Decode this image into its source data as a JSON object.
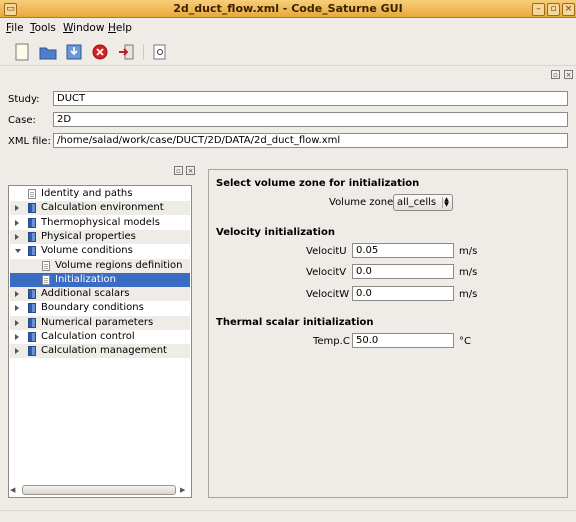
{
  "window": {
    "title": "2d_duct_flow.xml - Code_Saturne GUI"
  },
  "menubar": {
    "items": [
      {
        "label": "File",
        "key": "F",
        "rest": "ile"
      },
      {
        "label": "Tools",
        "key": "T",
        "rest": "ools"
      },
      {
        "label": "Window",
        "key": "W",
        "rest": "indow"
      },
      {
        "label": "Help",
        "key": "H",
        "rest": "elp"
      }
    ]
  },
  "toolbar": {
    "icons": [
      "new-file-icon",
      "open-folder-icon",
      "save-icon",
      "close-icon",
      "quit-icon",
      "preview-icon"
    ]
  },
  "identity": {
    "study_label": "Study:",
    "study_value": "DUCT",
    "case_label": "Case:",
    "case_value": "2D",
    "xml_label": "XML file:",
    "xml_value": "/home/salad/work/case/DUCT/2D/DATA/2d_duct_flow.xml"
  },
  "tree": {
    "items": [
      {
        "label": "Identity and paths",
        "level": 0,
        "arrow": "none",
        "icon": "page"
      },
      {
        "label": "Calculation environment",
        "level": 0,
        "arrow": "right",
        "icon": "book"
      },
      {
        "label": "Thermophysical models",
        "level": 0,
        "arrow": "right",
        "icon": "book"
      },
      {
        "label": "Physical properties",
        "level": 0,
        "arrow": "right",
        "icon": "book"
      },
      {
        "label": "Volume conditions",
        "level": 0,
        "arrow": "down",
        "icon": "book"
      },
      {
        "label": "Volume regions definition",
        "level": 1,
        "arrow": "none",
        "icon": "page"
      },
      {
        "label": "Initialization",
        "level": 1,
        "arrow": "none",
        "icon": "page",
        "selected": true
      },
      {
        "label": "Additional scalars",
        "level": 0,
        "arrow": "right",
        "icon": "book"
      },
      {
        "label": "Boundary conditions",
        "level": 0,
        "arrow": "right",
        "icon": "book"
      },
      {
        "label": "Numerical parameters",
        "level": 0,
        "arrow": "right",
        "icon": "book"
      },
      {
        "label": "Calculation control",
        "level": 0,
        "arrow": "right",
        "icon": "book"
      },
      {
        "label": "Calculation management",
        "level": 0,
        "arrow": "right",
        "icon": "book"
      }
    ]
  },
  "init": {
    "zone_title": "Select volume zone for initialization",
    "zone_label": "Volume zone",
    "zone_value": "all_cells",
    "velocity_title": "Velocity initialization",
    "u_label": "VelocitU",
    "u_value": "0.05",
    "u_unit": "m/s",
    "v_label": "VelocitV",
    "v_value": "0.0",
    "v_unit": "m/s",
    "w_label": "VelocitW",
    "w_value": "0.0",
    "w_unit": "m/s",
    "thermal_title": "Thermal scalar initialization",
    "temp_label": "Temp.C",
    "temp_value": "50.0",
    "temp_unit": "°C"
  },
  "colors": {
    "selection": "#3a6cc4",
    "titlebar": "#e8a83a",
    "background": "#efebe7"
  }
}
